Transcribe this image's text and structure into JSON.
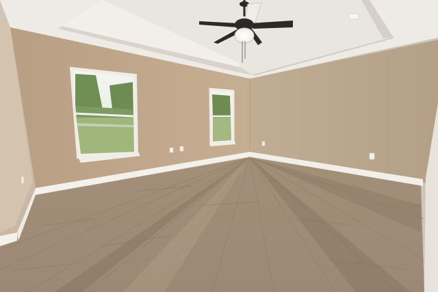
{
  "scene": {
    "kind": "photo",
    "subject": "empty room",
    "elements": [
      "tray-ceiling",
      "ceiling-fan-with-light",
      "left-window",
      "center-window",
      "electrical-outlets",
      "baseboards",
      "wood-laminate-floor"
    ]
  },
  "colors": {
    "ceiling": "#efece8",
    "tray": "#e6e2dd",
    "wall_left": "#c2a98e",
    "wall_center": "#bfa58a",
    "wall_right": "#b9a58c",
    "trim": "#f4f1ec",
    "floor_light": "#b29e85",
    "floor_dark": "#8a7560",
    "fan_dark": "#2c2a28",
    "window_sky": "#e8efe6",
    "window_trees": "#6f8f54",
    "window_grass": "#9fb77a"
  }
}
